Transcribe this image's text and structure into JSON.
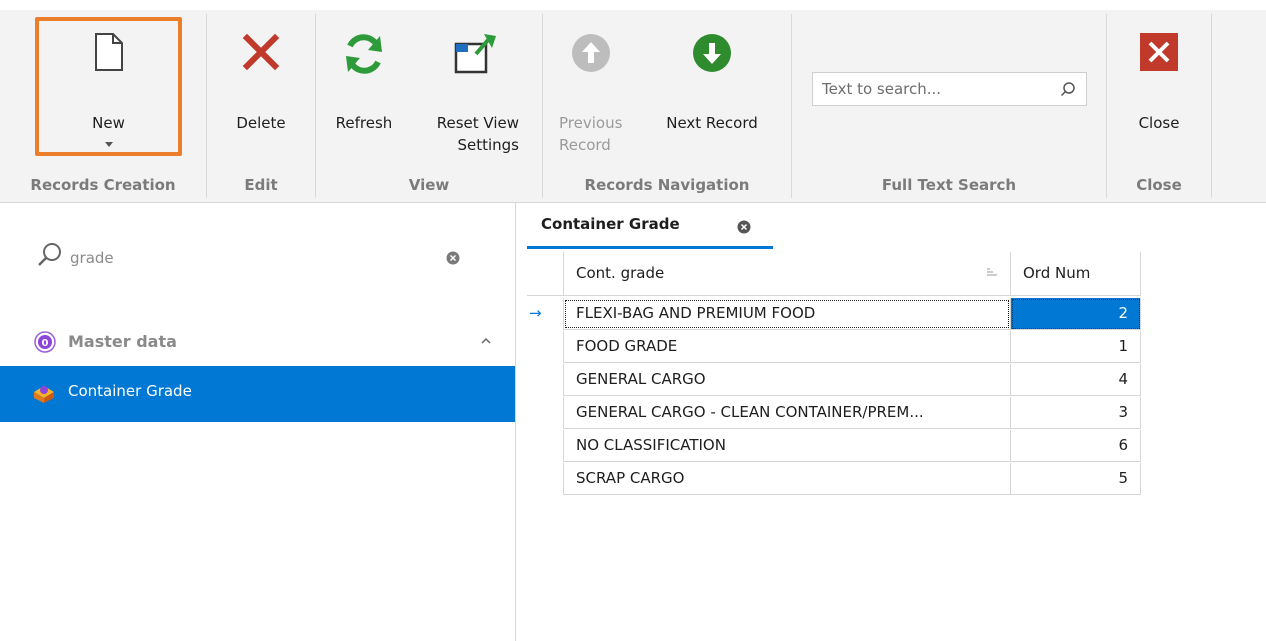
{
  "ribbon": {
    "groups": {
      "records_creation": "Records Creation",
      "edit": "Edit",
      "view": "View",
      "records_navigation": "Records Navigation",
      "full_text_search": "Full Text Search",
      "close": "Close"
    },
    "buttons": {
      "new": "New",
      "delete": "Delete",
      "refresh": "Refresh",
      "reset_view_1": "Reset View",
      "reset_view_2": "Settings",
      "previous_1": "Previous",
      "previous_2": "Record",
      "next_record": "Next Record",
      "close": "Close"
    },
    "search_placeholder": "Text to search..."
  },
  "nav": {
    "search_value": "grade",
    "group_label": "Master data",
    "item_label": "Container Grade"
  },
  "tab": {
    "label": "Container Grade"
  },
  "grid": {
    "columns": [
      "Cont. grade",
      "Ord Num"
    ],
    "rows": [
      {
        "grade": "FLEXI-BAG AND PREMIUM FOOD",
        "ord": "2"
      },
      {
        "grade": "FOOD GRADE",
        "ord": "1"
      },
      {
        "grade": "GENERAL CARGO",
        "ord": "4"
      },
      {
        "grade": "GENERAL CARGO - CLEAN CONTAINER/PREM...",
        "ord": "3"
      },
      {
        "grade": "NO CLASSIFICATION",
        "ord": "6"
      },
      {
        "grade": "SCRAP CARGO",
        "ord": "5"
      }
    ]
  },
  "colors": {
    "accent": "#0078d4",
    "highlight": "#ec7d2b",
    "delete_red": "#c0392b",
    "green": "#2e8b2e"
  }
}
